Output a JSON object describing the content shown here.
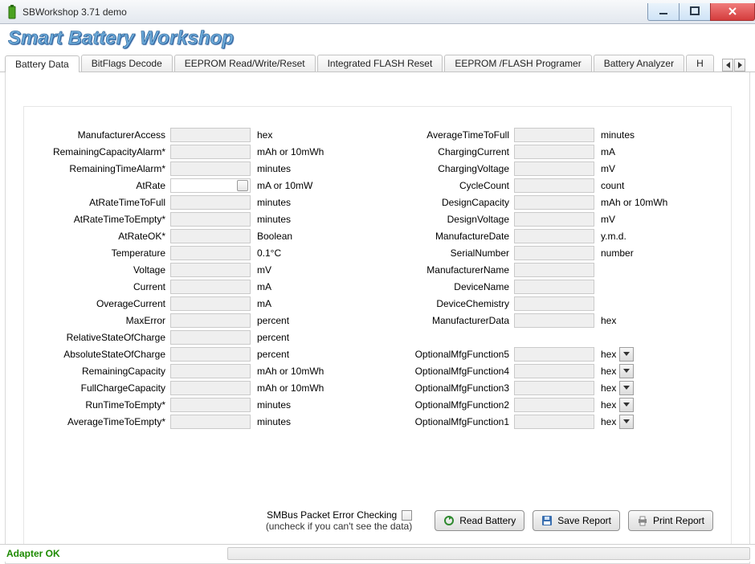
{
  "window": {
    "title": "SBWorkshop 3.71 demo"
  },
  "brand": "Smart Battery Workshop",
  "tabs": [
    "Battery Data",
    "BitFlags Decode",
    "EEPROM Read/Write/Reset",
    "Integrated FLASH Reset",
    "EEPROM /FLASH Programer",
    "Battery Analyzer",
    "H"
  ],
  "active_tab": 0,
  "left_fields": [
    {
      "label": "ManufacturerAccess",
      "unit": "hex"
    },
    {
      "label": "RemainingCapacityAlarm*",
      "unit": "mAh or 10mWh"
    },
    {
      "label": "RemainingTimeAlarm*",
      "unit": "minutes"
    },
    {
      "label": "AtRate",
      "unit": "mA or 10mW",
      "editable": true,
      "toggle": true
    },
    {
      "label": "AtRateTimeToFull",
      "unit": "minutes"
    },
    {
      "label": "AtRateTimeToEmpty*",
      "unit": "minutes"
    },
    {
      "label": "AtRateOK*",
      "unit": "Boolean"
    },
    {
      "label": "Temperature",
      "unit": "0.1°C"
    },
    {
      "label": "Voltage",
      "unit": "mV"
    },
    {
      "label": "Current",
      "unit": "mA"
    },
    {
      "label": "OverageCurrent",
      "unit": "mA"
    },
    {
      "label": "MaxError",
      "unit": "percent"
    },
    {
      "label": "RelativeStateOfCharge",
      "unit": "percent"
    },
    {
      "label": "AbsoluteStateOfCharge",
      "unit": "percent"
    },
    {
      "label": "RemainingCapacity",
      "unit": "mAh or 10mWh"
    },
    {
      "label": "FullChargeCapacity",
      "unit": "mAh or 10mWh"
    },
    {
      "label": "RunTimeToEmpty*",
      "unit": "minutes"
    },
    {
      "label": "AverageTimeToEmpty*",
      "unit": "minutes"
    }
  ],
  "right_fields_a": [
    {
      "label": "AverageTimeToFull",
      "unit": "minutes"
    },
    {
      "label": "ChargingCurrent",
      "unit": "mA"
    },
    {
      "label": "ChargingVoltage",
      "unit": "mV"
    },
    {
      "label": "CycleCount",
      "unit": "count"
    },
    {
      "label": "DesignCapacity",
      "unit": "mAh or 10mWh"
    },
    {
      "label": "DesignVoltage",
      "unit": "mV"
    },
    {
      "label": "ManufactureDate",
      "unit": "y.m.d."
    },
    {
      "label": "SerialNumber",
      "unit": "number"
    },
    {
      "label": "ManufacturerName",
      "unit": ""
    },
    {
      "label": "DeviceName",
      "unit": ""
    },
    {
      "label": "DeviceChemistry",
      "unit": ""
    },
    {
      "label": "ManufacturerData",
      "unit": "hex"
    }
  ],
  "right_fields_b": [
    {
      "label": "OptionalMfgFunction5",
      "unit": "hex",
      "combo": true
    },
    {
      "label": "OptionalMfgFunction4",
      "unit": "hex",
      "combo": true
    },
    {
      "label": "OptionalMfgFunction3",
      "unit": "hex",
      "combo": true
    },
    {
      "label": "OptionalMfgFunction2",
      "unit": "hex",
      "combo": true
    },
    {
      "label": "OptionalMfgFunction1",
      "unit": "hex",
      "combo": true
    }
  ],
  "pec": {
    "label": "SMBus Packet Error Checking",
    "hint": "(uncheck if you can't see the data)"
  },
  "buttons": {
    "read": "Read Battery",
    "save": "Save Report",
    "print": "Print Report"
  },
  "status": {
    "text": "Adapter OK"
  }
}
